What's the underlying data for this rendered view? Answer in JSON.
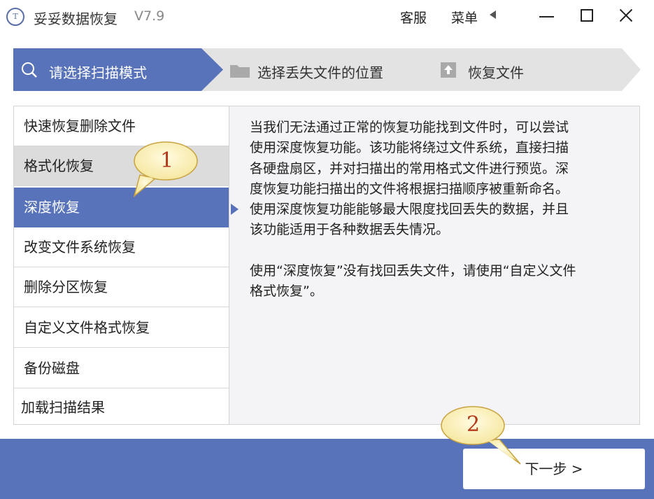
{
  "titlebar": {
    "logo_text": "T",
    "app_name": "妥妥数据恢复",
    "version": "V7.9",
    "support_label": "客服",
    "menu_label": "菜单"
  },
  "steps": [
    {
      "label": "请选择扫描模式",
      "icon": "search-icon",
      "active": true
    },
    {
      "label": "选择丢失文件的位置",
      "icon": "folder-icon",
      "active": false
    },
    {
      "label": "恢复文件",
      "icon": "upload-icon",
      "active": false
    }
  ],
  "modes": [
    {
      "label": "快速恢复删除文件"
    },
    {
      "label": "格式化恢复"
    },
    {
      "label": "深度恢复"
    },
    {
      "label": "改变文件系统恢复"
    },
    {
      "label": "删除分区恢复"
    },
    {
      "label": "自定义文件格式恢复"
    },
    {
      "label": "备份磁盘"
    },
    {
      "label": "加载扫描结果"
    }
  ],
  "selected_mode": "深度恢复",
  "description": {
    "line1": "当我们无法通过正常的恢复功能找到文件时，可以尝试",
    "line2": "使用深度恢复功能。该功能将绕过文件系统，直接扫描",
    "line3": "各硬盘扇区，并对扫描出的常用格式文件进行预览。深",
    "line4": "度恢复功能扫描出的文件将根据扫描顺序被重新命名。",
    "line5": "使用深度恢复功能能够最大限度找回丢失的数据，并且",
    "line6": "该功能适用于各种数据丢失情况。",
    "line7": "使用“深度恢复”没有找回丢失文件，请使用“自定义文件",
    "line8": "格式恢复”。"
  },
  "footer": {
    "next_label": "下一步 >"
  },
  "callouts": {
    "one": "1",
    "two": "2"
  },
  "colors": {
    "accent": "#5873b9",
    "callout_fill": "#fff8cc",
    "callout_text": "#b33a1a"
  }
}
